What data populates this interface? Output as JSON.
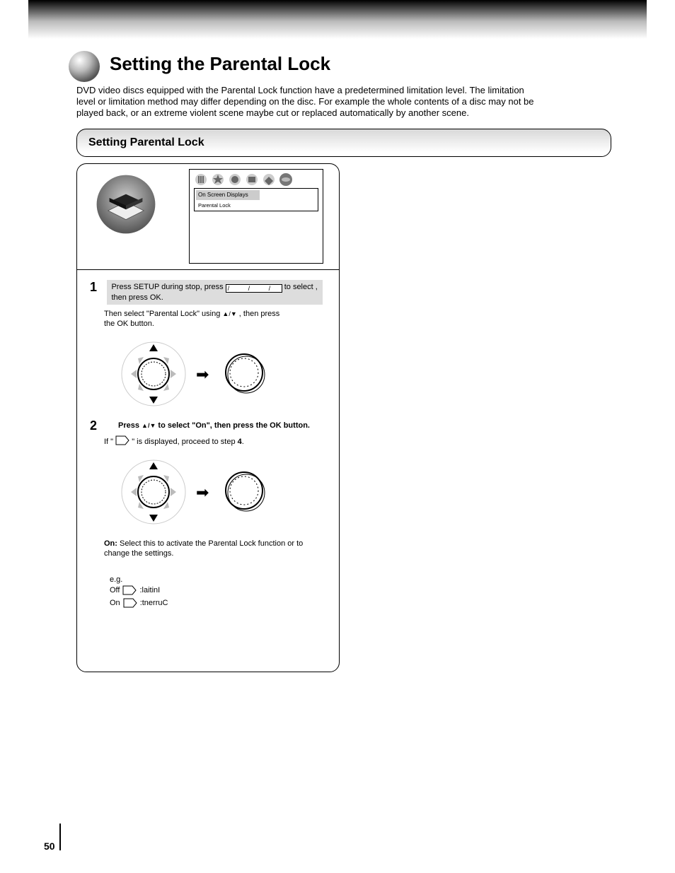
{
  "page_number": "50",
  "title": "Setting the Parental Lock",
  "subtitle_line1": "DVD video discs equipped with the Parental Lock function have a predetermined limitation level. The limitation",
  "subtitle_line2": "level or limitation method may differ depending on the disc. For example the whole contents of a disc may not be",
  "subtitle_line3": "played back, or an extreme violent scene maybe cut or replaced automatically by another scene.",
  "bar_title": "Setting Parental Lock",
  "osd_menu": {
    "item1": "On Screen Displays",
    "item2": "Parental Lock"
  },
  "step1": {
    "num": "1",
    "bar_pre": "Press SETUP during stop, press ",
    "bar_post": " to select           , then press OK.",
    "line1": "Then select \"Parental Lock\" using ",
    "line1_arrows": "▲/▼",
    "line1_end": ", then press",
    "line2": "the OK button."
  },
  "step2": {
    "num": "2",
    "head_pre": "Press ",
    "head_arrows": "▲/▼",
    "head_post": " to select \"On\", then press the OK button.",
    "line1": "If \"        \" is displayed, proceed to step ",
    "step_ref": "4",
    "line1_end": ".",
    "line2_label": "On:",
    "line2": "     Select this to activate the Parental Lock function or to change the settings.",
    "eg_label": "e.g.",
    "eg_off_pre": "Off",
    "eg_off_post": ":laitinI",
    "eg_on_pre": "On",
    "eg_on_post": ":tnerruC"
  }
}
